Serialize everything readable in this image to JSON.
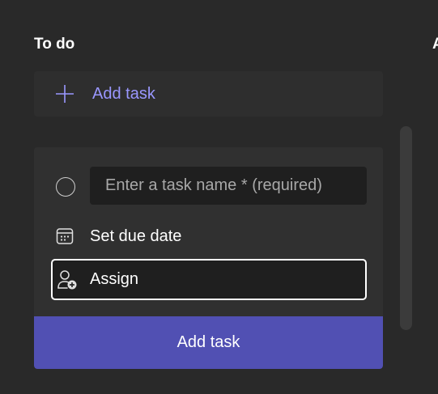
{
  "column": {
    "title": "To do",
    "next_title": "A"
  },
  "add_task_row": {
    "label": "Add task",
    "icon": "plus-icon"
  },
  "new_task_card": {
    "name_input": {
      "value": "",
      "placeholder": "Enter a task name * (required)"
    },
    "due_date": {
      "label": "Set due date",
      "icon": "calendar-icon"
    },
    "assign": {
      "label": "Assign",
      "icon": "person-add-icon"
    },
    "submit_label": "Add task"
  },
  "colors": {
    "background": "#292929",
    "card": "#303030",
    "input": "#1f1f1f",
    "accent_text": "#9a97ff",
    "primary_button": "#5150b3"
  }
}
